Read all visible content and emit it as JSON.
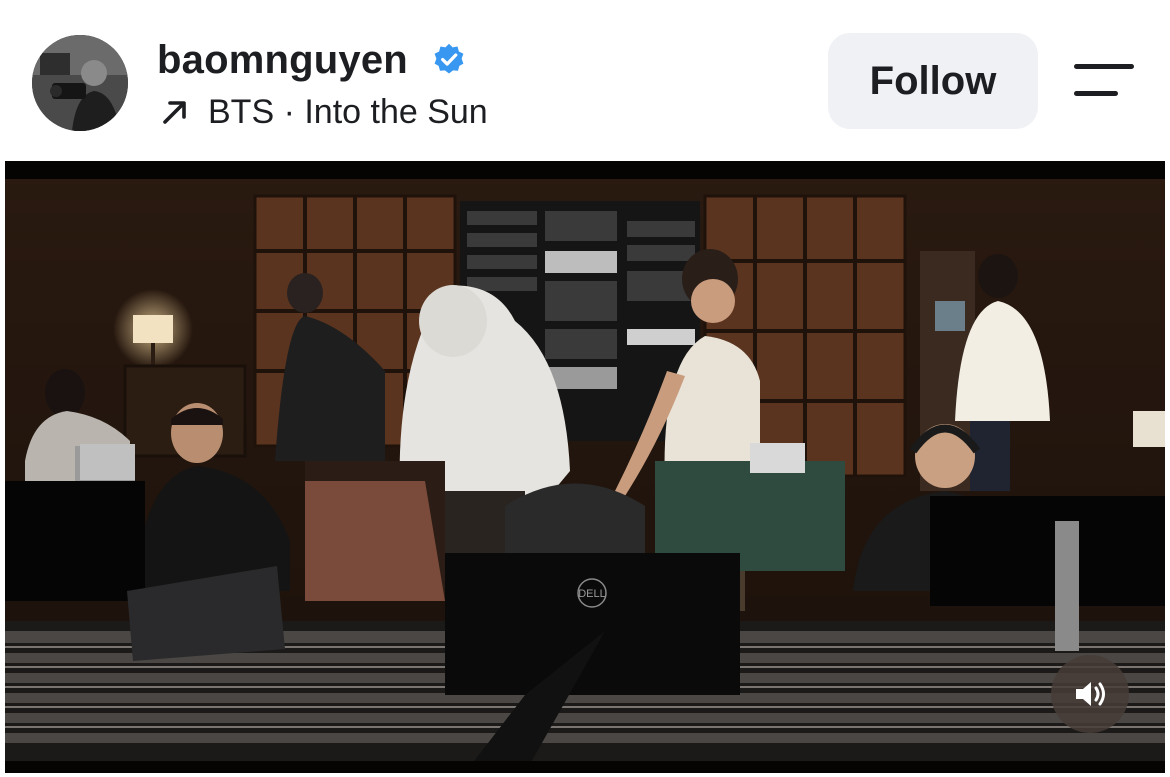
{
  "post": {
    "author": {
      "username": "baomnguyen",
      "verified": true,
      "avatar_icon": "profile-photo"
    },
    "music": {
      "icon": "arrow-up-right-icon",
      "label": "BTS · Into the Sun"
    },
    "follow_button": {
      "label": "Follow"
    },
    "menu_icon": "menu-lines-icon",
    "media": {
      "type": "video",
      "monitor_brand": "DELL",
      "volume_icon": "speaker-on-icon"
    }
  },
  "colors": {
    "verified_badge": "#3897f0",
    "follow_bg": "#eff1f5",
    "text": "#1c1e21"
  }
}
